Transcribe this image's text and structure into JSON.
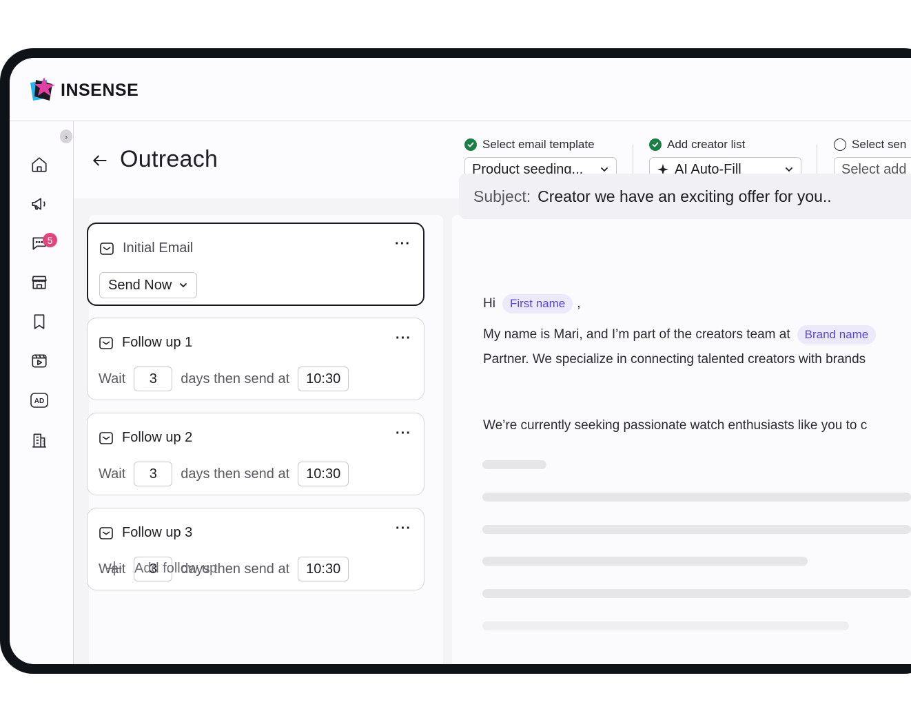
{
  "brand": {
    "name": "INSENSE"
  },
  "sidebar": {
    "items": [
      {
        "icon": "home-icon"
      },
      {
        "icon": "megaphone-icon"
      },
      {
        "icon": "chat-icon",
        "badge": "5"
      },
      {
        "icon": "store-icon"
      },
      {
        "icon": "bookmark-icon"
      },
      {
        "icon": "video-icon"
      },
      {
        "icon": "ad-icon",
        "label": "AD"
      },
      {
        "icon": "building-icon"
      }
    ]
  },
  "header": {
    "title": "Outreach",
    "steps": [
      {
        "label": "Select email template",
        "done": true,
        "value": "Product seeding..."
      },
      {
        "label": "Add creator list",
        "done": true,
        "value": "AI Auto-Fill"
      },
      {
        "label": "Select sen",
        "done": false,
        "value": "Select add"
      }
    ]
  },
  "sequence": {
    "initial": {
      "title": "Initial Email",
      "send_label": "Send Now"
    },
    "followups": [
      {
        "title": "Follow up 1",
        "wait_label": "Wait",
        "days": "3",
        "then_label": "days then send at",
        "time": "10:30"
      },
      {
        "title": "Follow up 2",
        "wait_label": "Wait",
        "days": "3",
        "then_label": "days then send at",
        "time": "10:30"
      },
      {
        "title": "Follow up 3",
        "wait_label": "Wait",
        "days": "3",
        "then_label": "days then send at",
        "time": "10:30"
      }
    ],
    "add_label": "Add follow up"
  },
  "email": {
    "subject_label": "Subject:",
    "subject": "Creator we have an exciting offer for you..",
    "greeting": "Hi",
    "first_name_chip": "First name",
    "comma": ",",
    "line1": "My name is Mari, and I’m part of the creators team at",
    "brand_chip": "Brand name",
    "line2": "Partner. We specialize in connecting talented creators with brands",
    "line3": "We’re currently seeking passionate watch enthusiasts like you to c"
  }
}
